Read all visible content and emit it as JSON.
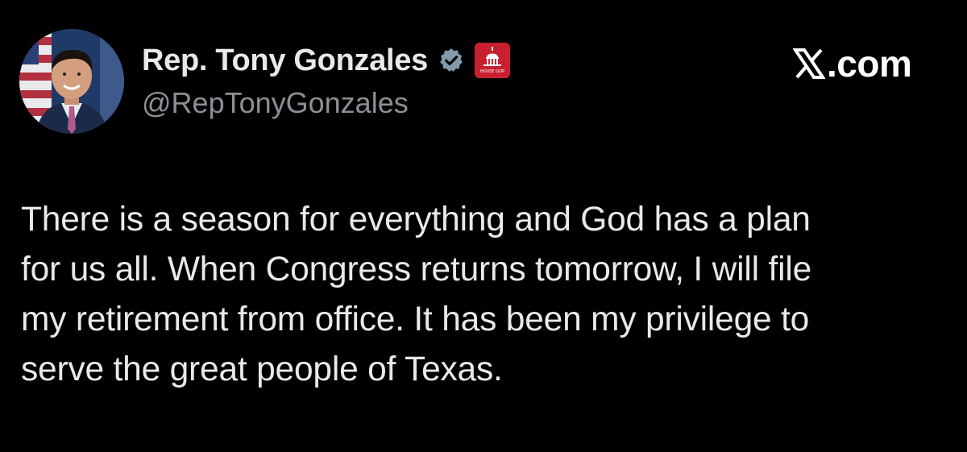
{
  "author": {
    "display_name": "Rep. Tony Gonzales",
    "handle": "@RepTonyGonzales",
    "verified_icon": "verified-badge-icon",
    "affiliation_icon": "house-gop-capitol-icon",
    "affiliation_badge_text": "HOUSE GOP"
  },
  "source": {
    "site_label": ".com",
    "logo_icon": "x-logo-icon"
  },
  "tweet": {
    "text": "There is a season for everything and God has a plan\nfor us all. When Congress returns tomorrow, I will file\nmy retirement from office. It has been my privilege to\nserve the great people of Texas."
  },
  "colors": {
    "background": "#000000",
    "primary_text": "#e7e9ea",
    "secondary_text": "#8b9096",
    "verified_badge": "#829aab",
    "affiliation_badge": "#c8202f"
  }
}
